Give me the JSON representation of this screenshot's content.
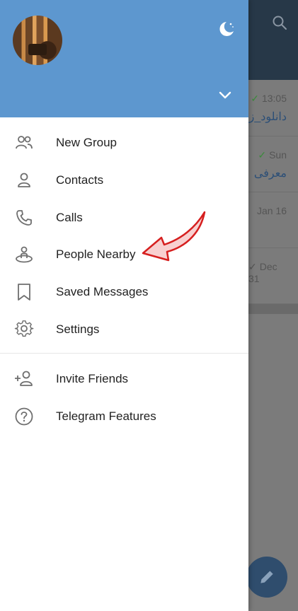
{
  "background": {
    "chats": [
      {
        "time": "13:05",
        "checked": true,
        "snippet": "دانلود_ز"
      },
      {
        "time": "Sun",
        "checked": true,
        "snippet": "معرفی"
      },
      {
        "time": "Jan 16",
        "checked": false,
        "snippet": ""
      },
      {
        "time": "Dec 31",
        "checked": true,
        "snippet": ""
      }
    ]
  },
  "drawer": {
    "menu": [
      {
        "label": "New Group",
        "icon": "group-icon"
      },
      {
        "label": "Contacts",
        "icon": "person-icon"
      },
      {
        "label": "Calls",
        "icon": "phone-icon"
      },
      {
        "label": "People Nearby",
        "icon": "people-nearby-icon"
      },
      {
        "label": "Saved Messages",
        "icon": "bookmark-icon"
      },
      {
        "label": "Settings",
        "icon": "gear-icon"
      },
      {
        "label": "Invite Friends",
        "icon": "add-person-icon"
      },
      {
        "label": "Telegram Features",
        "icon": "question-icon"
      }
    ]
  },
  "colors": {
    "header": "#5d97cf",
    "arrow_fill": "#f8d0d0",
    "arrow_stroke": "#d61f1f"
  }
}
